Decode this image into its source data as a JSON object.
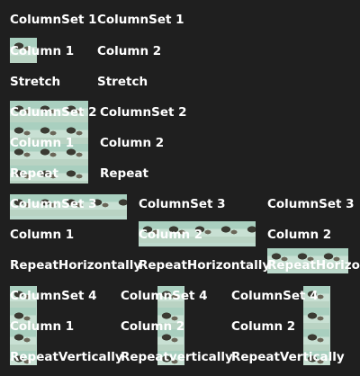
{
  "row1": {
    "a": {
      "title": "ColumnSet 1",
      "column": "Column 1",
      "mode": "Stretch"
    },
    "b": {
      "title": "ColumnSet 1",
      "column": "Column 2",
      "mode": "Stretch"
    }
  },
  "row2": {
    "a": {
      "title": "ColumnSet 2",
      "column": "Column 1",
      "mode": "Repeat"
    },
    "b": {
      "title": "ColumnSet 2",
      "column": "Column 2",
      "mode": "Repeat"
    }
  },
  "row3": {
    "a": {
      "title": "ColumnSet 3",
      "column": "Column 1",
      "mode": "RepeatHorizontally"
    },
    "b": {
      "title": "ColumnSet 3",
      "column": "Column 2",
      "mode": "RepeatHorizontally"
    },
    "c": {
      "title": "ColumnSet 3",
      "column": "Column 2",
      "mode": "RepeatHorizo"
    }
  },
  "row4": {
    "a": {
      "title": "ColumnSet 4",
      "column": "Column 1",
      "mode": "RepeatVertically"
    },
    "b": {
      "title": "ColumnSet 4",
      "column": "Column 2",
      "mode": "Repeatvertically"
    },
    "c": {
      "title": "ColumnSet 4",
      "column": "Column 2",
      "mode": "RepeatVertically"
    }
  }
}
